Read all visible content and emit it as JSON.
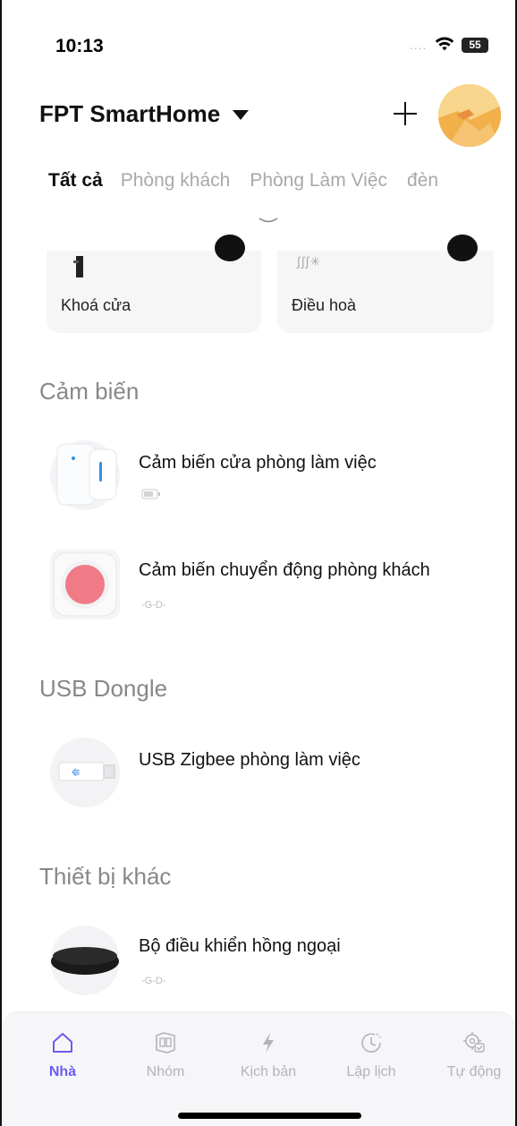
{
  "status_bar": {
    "time": "10:13",
    "signal": "....",
    "battery": "55"
  },
  "header": {
    "home_name": "FPT SmartHome"
  },
  "tabs": [
    {
      "label": "Tất cả",
      "active": true
    },
    {
      "label": "Phòng khách",
      "active": false
    },
    {
      "label": "Phòng Làm Việc",
      "active": false
    },
    {
      "label": "đèn",
      "active": false
    }
  ],
  "cards": [
    {
      "label": "Khoá cửa",
      "icon": "door-lock-icon"
    },
    {
      "label": "Điều hoà",
      "icon": "air-conditioner-icon",
      "icon_text": "∫∫∫✳"
    }
  ],
  "sections": [
    {
      "title": "Cảm biến",
      "devices": [
        {
          "name": "Cảm biến cửa phòng làm việc",
          "status_icon": "battery-icon"
        },
        {
          "name": "Cảm biến chuyển động phòng khách",
          "status_icon": "plug-icon",
          "status_text": "-G-D-"
        }
      ]
    },
    {
      "title": "USB Dongle",
      "devices": [
        {
          "name": "USB Zigbee phòng làm việc",
          "status_icon": ""
        }
      ]
    },
    {
      "title": "Thiết bị khác",
      "devices": [
        {
          "name": "Bộ điều khiển hồng ngoại",
          "status_icon": "plug-icon",
          "status_text": "-G-D-"
        }
      ]
    }
  ],
  "bottom_nav": [
    {
      "label": "Nhà",
      "icon": "home-icon",
      "active": true
    },
    {
      "label": "Nhóm",
      "icon": "group-icon",
      "active": false
    },
    {
      "label": "Kịch bản",
      "icon": "lightning-icon",
      "active": false
    },
    {
      "label": "Lập lịch",
      "icon": "clock-icon",
      "active": false
    },
    {
      "label": "Tự động",
      "icon": "automation-gear-icon",
      "active": false
    }
  ],
  "colors": {
    "accent": "#6b5cf0",
    "inactive": "#b4b4b8",
    "card_bg": "#f6f6f7"
  }
}
